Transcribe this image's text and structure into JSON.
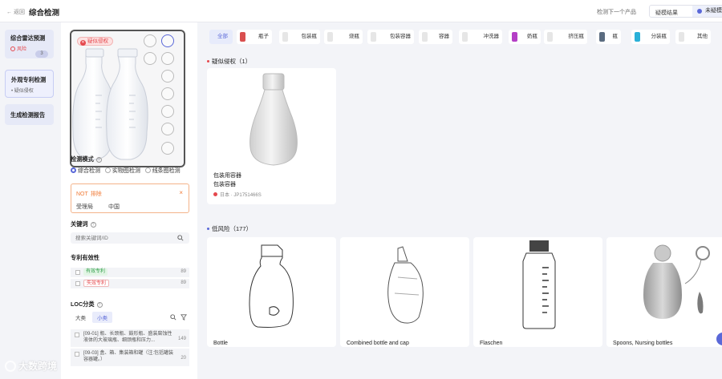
{
  "topbar": {
    "back_label": "← 返回",
    "title": "综合检测",
    "next_product": "检测下一个产品",
    "seg_left": "疑模结果",
    "seg_right": "未疑模"
  },
  "steps": [
    {
      "title": "综合雷达预测",
      "sub": "风险",
      "count": "3"
    },
    {
      "title": "外观专利检测",
      "sub": "• 疑似侵权"
    },
    {
      "title": "生成检测报告"
    }
  ],
  "product_image": {
    "badge": "疑似侵权"
  },
  "detect_mode": {
    "label": "检测模式",
    "options": [
      "综合检测",
      "实物图检测",
      "线条图检测"
    ],
    "selected": 0
  },
  "not_filter": {
    "title": "NOT",
    "exclude": "排除",
    "key": "受理局",
    "value": "中国"
  },
  "keywords": {
    "label": "关键词",
    "placeholder": "搜索关键词/ID"
  },
  "validity": {
    "label": "专利有效性",
    "items": [
      {
        "tag": "有效专利",
        "count": "89"
      },
      {
        "tag": "失效专利",
        "count": "89"
      }
    ]
  },
  "loc": {
    "label": "LOC分类",
    "tabs": [
      "大类",
      "小类"
    ],
    "items": [
      {
        "text": "[09-01] 瓶、长颈瓶、鼓形瓶、盛装腐蚀性液体的大玻璃瓶、细颈瓶和压力...",
        "count": "149"
      },
      {
        "text": "[09-03] 盒、箱、集装箱和罐（注:包括罐装容器罐。）",
        "count": "20"
      }
    ]
  },
  "categories": [
    {
      "label": "全部"
    },
    {
      "label": "瓶子",
      "color": "#d94f4f"
    },
    {
      "label": "包装瓶",
      "color": "#e6e6e6"
    },
    {
      "label": "烧瓶",
      "color": "#e6e6e6"
    },
    {
      "label": "包装容器",
      "color": "#e6e6e6"
    },
    {
      "label": "容器",
      "color": "#e6e6e6"
    },
    {
      "label": "冲洗器",
      "color": "#e6e6e6"
    },
    {
      "label": "奶瓶",
      "color": "#b43fc6"
    },
    {
      "label": "挤压瓶",
      "color": "#e6e6e6"
    },
    {
      "label": "瓶",
      "color": "#5b6c80"
    },
    {
      "label": "分装瓶",
      "color": "#2ab0d8"
    },
    {
      "label": "其他",
      "color": "#e6e6e6"
    }
  ],
  "suspected": {
    "title": "疑似侵权（1）",
    "card": {
      "name1": "包装用容器",
      "name2": "包装容器",
      "country": "日本",
      "id": "JP1751466S"
    }
  },
  "low_risk": {
    "title": "低风险（177）",
    "cards": [
      "Bottle",
      "Combined bottle and cap",
      "Flaschen",
      "Spoons, Nursing bottles"
    ]
  },
  "watermark": "大数跨境",
  "colors": {
    "accent": "#5a68d8",
    "danger": "#e5484d",
    "warn": "#f07b37"
  }
}
